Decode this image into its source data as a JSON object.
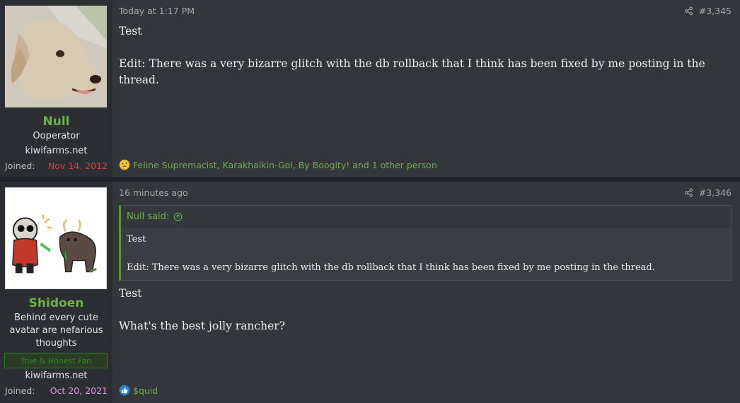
{
  "posts": [
    {
      "username": "Null",
      "user_title": "Ooperator",
      "site": "kiwifarms.net",
      "joined_label": "Joined:",
      "joined_date": "Nov 14, 2012",
      "timestamp": "Today at 1:17 PM",
      "post_number": "#3,345",
      "message": [
        "Test",
        "Edit: There was a very bizarre glitch with the db rollback that I think has been fixed by me posting in the thread."
      ],
      "reactions_text": "Feline Supremacist, Karakhalkin-Gol, By Boogity! and 1 other person",
      "reaction_icon": "thinking-emoji-icon",
      "avatar_icon": "dog-avatar-icon"
    },
    {
      "username": "Shidoen",
      "user_title": "Behind every cute avatar are nefarious thoughts",
      "banner": "True & Honest Fan",
      "site": "kiwifarms.net",
      "joined_label": "Joined:",
      "joined_date": "Oct 20, 2021",
      "timestamp": "16 minutes ago",
      "post_number": "#3,346",
      "quote": {
        "author_label": "Null said:",
        "lines": [
          "Test",
          "Edit: There was a very bizarre glitch with the db rollback that I think has been fixed by me posting in the thread."
        ]
      },
      "message": [
        "Test",
        "What's the best jolly rancher?"
      ],
      "reactions_text": "$quid",
      "reaction_icon": "like-thumb-icon",
      "avatar_icon": "cartoon-avatar-icon"
    }
  ],
  "colors": {
    "username_green": "#6fb04a",
    "joined_red": "#d0453f",
    "joined_pink": "#e39ae3",
    "background": "#33363b",
    "sidebar": "#2b2e33"
  }
}
